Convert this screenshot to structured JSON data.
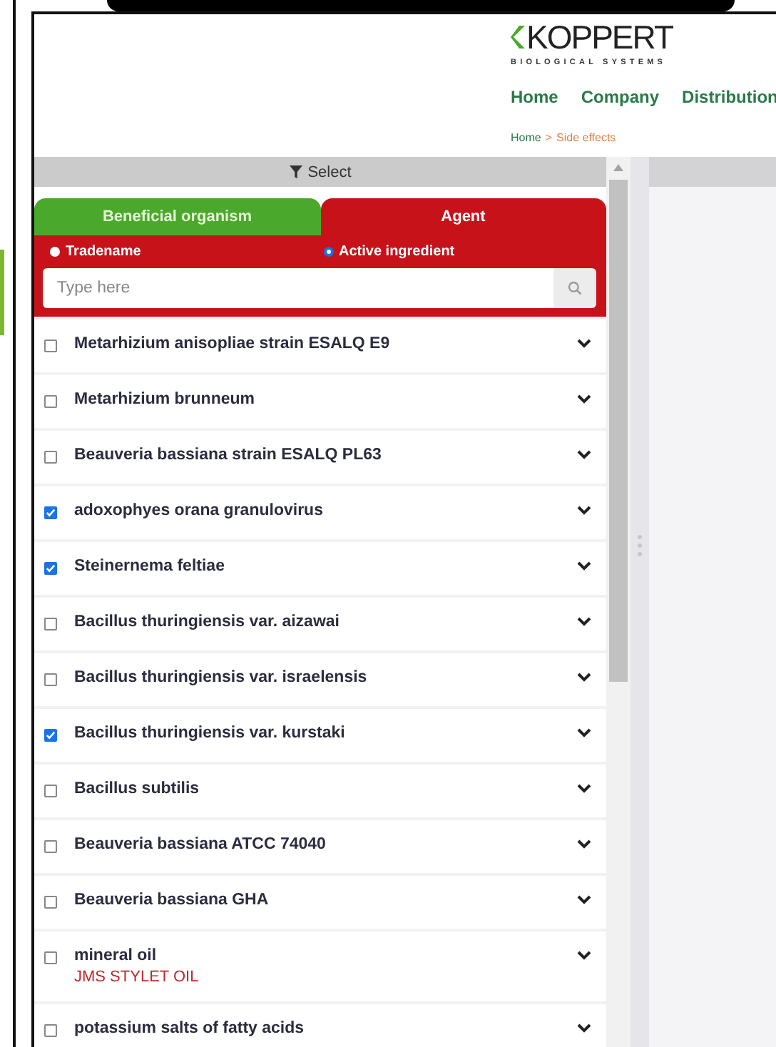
{
  "logo": {
    "name": "KOPPERT",
    "tagline": "BIOLOGICAL SYSTEMS"
  },
  "nav": [
    {
      "label": "Home"
    },
    {
      "label": "Company"
    },
    {
      "label": "Distribution"
    }
  ],
  "breadcrumb": {
    "separator": ">",
    "items": [
      {
        "label": "Home",
        "current": false
      },
      {
        "label": "Side effects",
        "current": true
      }
    ]
  },
  "select": {
    "label": "Select"
  },
  "tabs": [
    {
      "label": "Beneficial organism",
      "selected": false,
      "color": "#4aa92c"
    },
    {
      "label": "Agent",
      "selected": true,
      "color": "#c8121a"
    }
  ],
  "radios": [
    {
      "label": "Tradename",
      "selected": false
    },
    {
      "label": "Active ingredient",
      "selected": true
    }
  ],
  "search": {
    "placeholder": "Type here"
  },
  "items": [
    {
      "name": "Metarhizium anisopliae strain ESALQ E9",
      "checked": false
    },
    {
      "name": "Metarhizium brunneum",
      "checked": false
    },
    {
      "name": "Beauveria bassiana strain ESALQ PL63",
      "checked": false
    },
    {
      "name": "adoxophyes orana granulovirus",
      "checked": true
    },
    {
      "name": "Steinernema feltiae",
      "checked": true
    },
    {
      "name": "Bacillus thuringiensis var. aizawai",
      "checked": false
    },
    {
      "name": "Bacillus thuringiensis var. israelensis",
      "checked": false
    },
    {
      "name": "Bacillus thuringiensis var. kurstaki",
      "checked": true
    },
    {
      "name": "Bacillus subtilis",
      "checked": false
    },
    {
      "name": "Beauveria bassiana ATCC 74040",
      "checked": false
    },
    {
      "name": "Beauveria bassiana GHA",
      "checked": false
    },
    {
      "name": "mineral oil",
      "checked": false,
      "product": "JMS STYLET OIL"
    },
    {
      "name": "potassium salts of fatty acids",
      "checked": false
    }
  ]
}
